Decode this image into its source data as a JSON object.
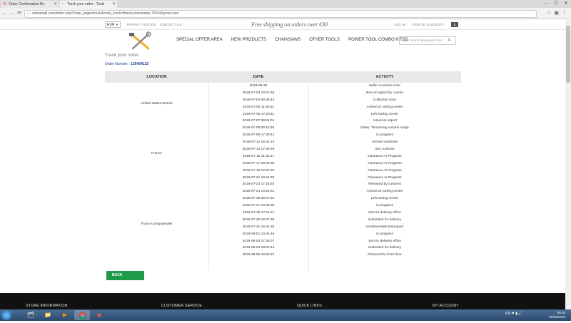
{
  "browser": {
    "tabs": [
      {
        "title": "Order Confirmation No",
        "icon": "gmail-icon"
      },
      {
        "title": "Track your order : Tools",
        "icon": "tools-icon"
      }
    ],
    "url": "alonamall.com/index.php?main_page=track&entry_track=thierry.menardais.76%40gmail.com"
  },
  "topbar": {
    "currency": "EUR",
    "links": [
      "PRIVACY NOTICE",
      "CONTACT US"
    ],
    "promo": "Free shipping on orders over €30",
    "login": "LOG IN",
    "create_account": "CREATE ACCOUNT",
    "cart_count": "0"
  },
  "nav": {
    "items": [
      "SPECIAL OFFER AREA",
      "NEW PRODUCTS",
      "CHAINSAWS",
      "OTHER TOOLS",
      "POWER TOOL COMBO KITSS"
    ],
    "search_placeholder": "Enter search keywords here"
  },
  "page": {
    "title": "Track your order",
    "order_label": "Order Number :",
    "order_number": "135404122"
  },
  "table": {
    "headers": [
      "LOCATION",
      "DATE",
      "ACTIVITY"
    ],
    "locations": [
      "United States,Detroit",
      "France",
      "France,Sorquainville"
    ],
    "rows": [
      {
        "date": "2018-06-29",
        "activity": "Seller received order"
      },
      {
        "date": "2018-07-03 16:01:56",
        "activity": "Item accepted by courier"
      },
      {
        "date": "2018-07-04 08:46:43",
        "activity": "Collection scan"
      },
      {
        "date": "2018-07-05 11:54:51",
        "activity": "Arrived at sorting center"
      },
      {
        "date": "2018-07-06 17:23:11",
        "activity": "Left sorting center"
      },
      {
        "date": "2018-07-07 09:51:04",
        "activity": "Arrival at Airport"
      },
      {
        "date": "2018-07-08 08:15:35",
        "activity": "Delay: Temporary volume surge"
      },
      {
        "date": "2018-07-09 17:39:42",
        "activity": "in progress"
      },
      {
        "date": "2018-07-12 15:42:13",
        "activity": "Arrived overseas"
      },
      {
        "date": "2018-07-13 17:09:29",
        "activity": "Into customs"
      },
      {
        "date": "2018-07-15 11:43:17",
        "activity": "Clearance in Progress"
      },
      {
        "date": "2018-07-17 09:42:09",
        "activity": "Clearance in Progress"
      },
      {
        "date": "2018-07-19 16:37:50",
        "activity": "Clearance in Progress"
      },
      {
        "date": "2018-07-21 10:44:30",
        "activity": "Clearance in Progress"
      },
      {
        "date": "2018-07-23 17:18:50",
        "activity": "Released by customs"
      },
      {
        "date": "2018-07-24 10:22:01",
        "activity": "Arrived at sorting center"
      },
      {
        "date": "2018-07-25 09:47:54",
        "activity": "Left sorting center"
      },
      {
        "date": "2018-07-27 10:38:06",
        "activity": "in progress"
      },
      {
        "date": "2018-07-29 17:11:14",
        "activity": "Sent to delivery office"
      },
      {
        "date": "2018-07-30 16:37:39",
        "activity": "Submitted for delivery"
      },
      {
        "date": "2018-07-31 15:34:38",
        "activity": "Undeliverable Marouped"
      },
      {
        "date": "2018-08-01 10:44:48",
        "activity": "in progress"
      },
      {
        "date": "2018-08-03 17:38:07",
        "activity": "Sent to delivery office"
      },
      {
        "date": "2018-08-04 08:52:44",
        "activity": "Submitted for delivery"
      },
      {
        "date": "2018-08-05 16:29:22",
        "activity": "Delivered to front door"
      }
    ]
  },
  "back_button": "BACK",
  "footer": {
    "headings": [
      "STORE INFORMATION",
      "CUSTOMER SERVICE",
      "QUICK LINKS",
      "MY ACCOUNT"
    ]
  },
  "taskbar": {
    "lang": "EN",
    "time": "09:30",
    "date": "06/09/2018"
  },
  "colors": {
    "accent_green": "#1e9a4a",
    "order_blue": "#1a3f8f",
    "footer_bg": "#111111"
  }
}
